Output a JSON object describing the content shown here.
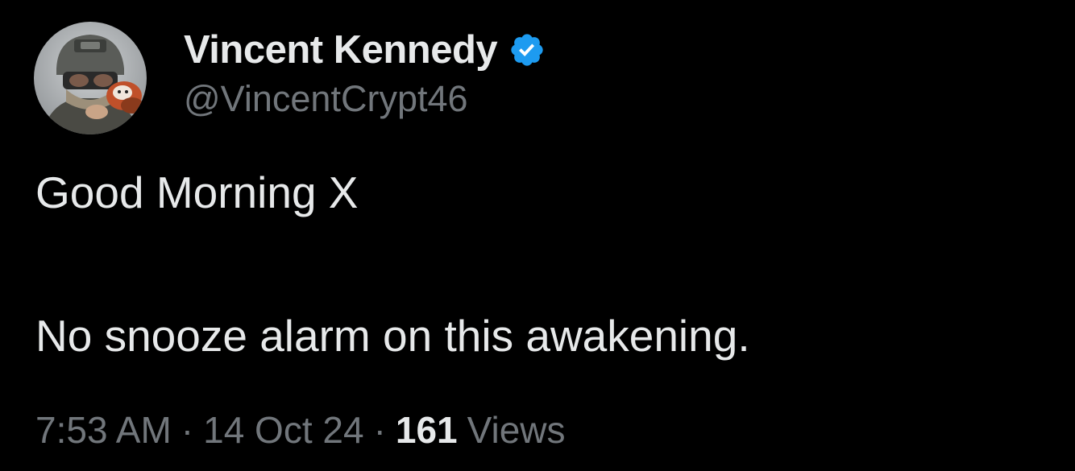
{
  "author": {
    "name": "Vincent Kennedy",
    "handle": "@VincentCrypt46",
    "verified": true,
    "badge_icon": "verified-badge-icon",
    "badge_color": "#1d9bf0",
    "avatar_icon": "avatar-image"
  },
  "tweet": {
    "lines": [
      "Good Morning X",
      "No snooze alarm on this awakening."
    ]
  },
  "meta": {
    "time": "7:53 AM",
    "separator": "·",
    "date": "14 Oct 24",
    "views_count": "161",
    "views_label": "Views"
  },
  "colors": {
    "background": "#000000",
    "primary_text": "#e7e9ea",
    "secondary_text": "#71767b"
  }
}
